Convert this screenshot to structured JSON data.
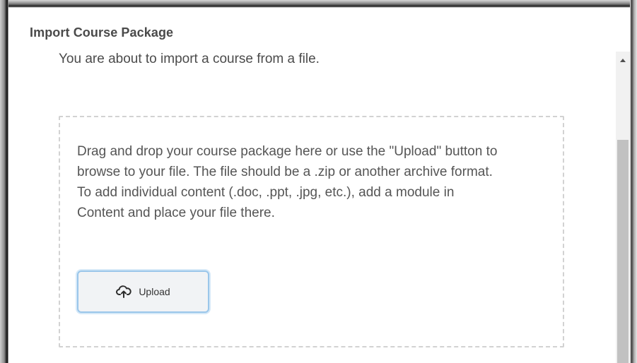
{
  "dialog": {
    "title": "Import Course Package",
    "subtitle": "You are about to import a course from a file."
  },
  "dropzone": {
    "instructions": "Drag and drop your course package here or use the \"Upload\" button to browse to your file. The file should be a .zip or another archive format. To add individual content (.doc, .ppt, .jpg, etc.), add a module in Content and place your file there.",
    "upload_button": {
      "label": "Upload",
      "icon": "cloud-upload-icon"
    }
  },
  "scrollbar": {
    "up_arrow_icon": "chevron-up-icon"
  },
  "colors": {
    "title_text": "#4a4a4a",
    "body_text": "#555555",
    "dropzone_border": "#d2d2d2",
    "button_focus_ring": "#9ac6ea",
    "button_bg": "#f1f3f5"
  }
}
